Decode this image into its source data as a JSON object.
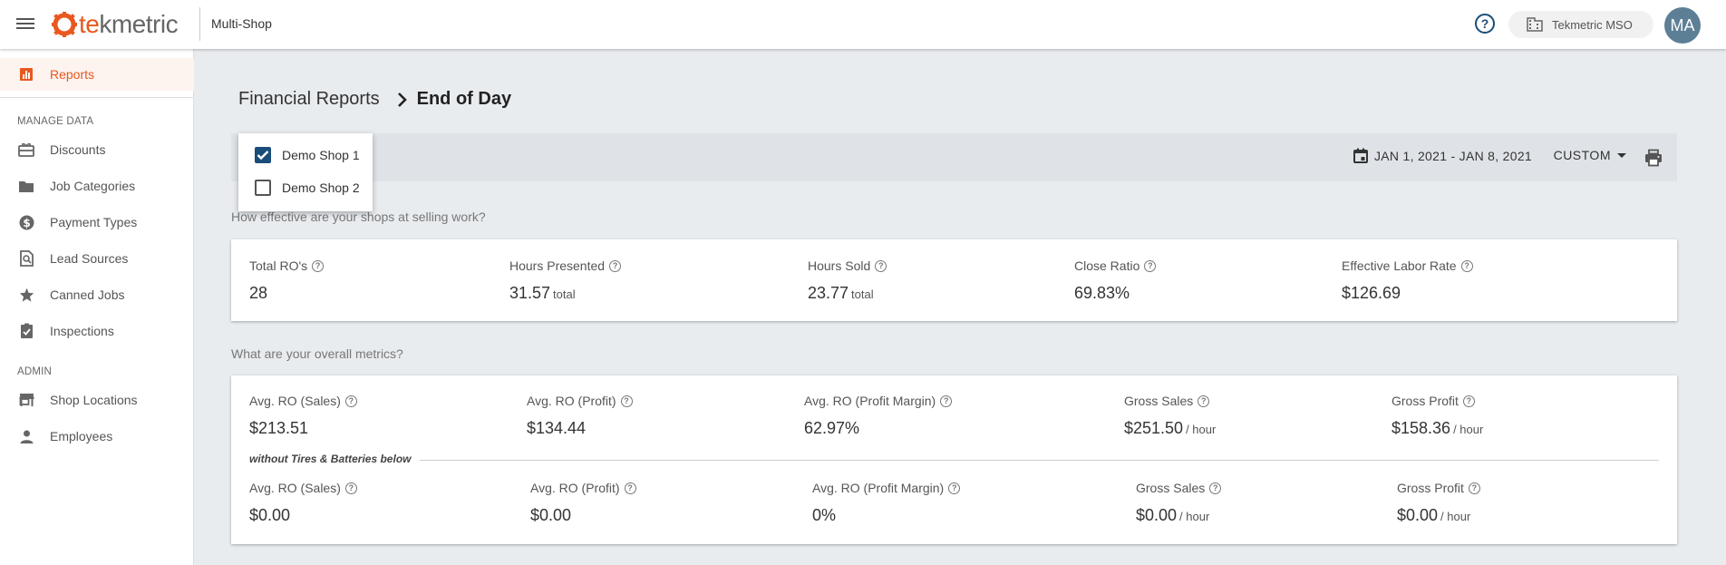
{
  "topbar": {
    "logo_te": "te",
    "logo_rest": "kmetric",
    "mode": "Multi-Shop",
    "shop_chip": "Tekmetric MSO",
    "avatar": "MA",
    "help_glyph": "?"
  },
  "sidebar": {
    "reports": "Reports",
    "manage_data_title": "MANAGE DATA",
    "manage_items": [
      "Discounts",
      "Job Categories",
      "Payment Types",
      "Lead Sources",
      "Canned Jobs",
      "Inspections"
    ],
    "admin_title": "ADMIN",
    "admin_items": [
      "Shop Locations",
      "Employees"
    ]
  },
  "breadcrumb": {
    "parent": "Financial Reports",
    "current": "End of Day"
  },
  "filter": {
    "date_range": "JAN 1, 2021 - JAN 8, 2021",
    "range_select": "CUSTOM",
    "shops": [
      {
        "label": "Demo Shop 1",
        "checked": true
      },
      {
        "label": "Demo Shop 2",
        "checked": false
      }
    ]
  },
  "selling": {
    "question": "How effective are your shops at selling work?",
    "metrics": [
      {
        "label": "Total RO's",
        "value": "28",
        "unit": ""
      },
      {
        "label": "Hours Presented",
        "value": "31.57",
        "unit": "total"
      },
      {
        "label": "Hours Sold",
        "value": "23.77",
        "unit": "total"
      },
      {
        "label": "Close Ratio",
        "value": "69.83%",
        "unit": ""
      },
      {
        "label": "Effective Labor Rate",
        "value": "$126.69",
        "unit": ""
      }
    ]
  },
  "overall": {
    "question": "What are your overall metrics?",
    "metrics": [
      {
        "label": "Avg. RO (Sales)",
        "value": "$213.51",
        "unit": ""
      },
      {
        "label": "Avg. RO (Profit)",
        "value": "$134.44",
        "unit": ""
      },
      {
        "label": "Avg. RO (Profit Margin)",
        "value": "62.97%",
        "unit": ""
      },
      {
        "label": "Gross Sales",
        "value": "$251.50",
        "unit": "/ hour"
      },
      {
        "label": "Gross Profit",
        "value": "$158.36",
        "unit": "/ hour"
      }
    ],
    "without_label": "without Tires & Batteries below",
    "without_metrics": [
      {
        "label": "Avg. RO (Sales)",
        "value": "$0.00",
        "unit": ""
      },
      {
        "label": "Avg. RO (Profit)",
        "value": "$0.00",
        "unit": ""
      },
      {
        "label": "Avg. RO (Profit Margin)",
        "value": "0%",
        "unit": ""
      },
      {
        "label": "Gross Sales",
        "value": "$0.00",
        "unit": "/ hour"
      },
      {
        "label": "Gross Profit",
        "value": "$0.00",
        "unit": "/ hour"
      }
    ]
  },
  "colors": {
    "brand": "#e8581f",
    "navy": "#1a4d7a",
    "avatar": "#5d7f95"
  },
  "icons": {
    "menu": "hamburger-menu-icon",
    "help": "help-circle-icon",
    "building": "building-icon",
    "reports": "bar-chart-icon",
    "discounts": "gift-card-icon",
    "job_categories": "folder-icon",
    "payment_types": "dollar-circle-icon",
    "lead_sources": "find-in-page-icon",
    "canned_jobs": "star-icon",
    "inspections": "assignment-check-icon",
    "shop_locations": "store-icon",
    "employees": "person-icon",
    "calendar": "calendar-icon",
    "print": "print-icon"
  }
}
